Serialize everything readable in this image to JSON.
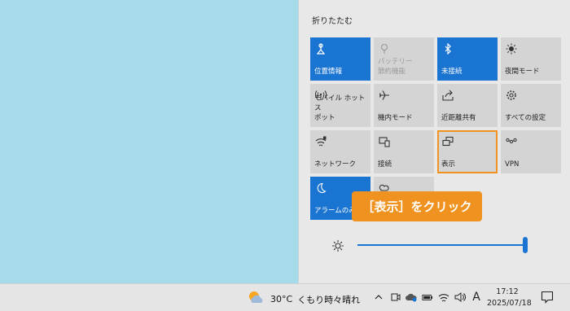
{
  "action_center": {
    "collapse_label": "折りたたむ",
    "tiles": [
      {
        "label": "位置情報",
        "icon": "location-icon",
        "state": "active"
      },
      {
        "label": "バッテリー\n節約機能",
        "icon": "battery-saver-icon",
        "state": "disabled"
      },
      {
        "label": "未接続",
        "icon": "bluetooth-icon",
        "state": "active"
      },
      {
        "label": "夜間モード",
        "icon": "brightness-icon",
        "state": "normal"
      },
      {
        "label": "モバイル ホットス\nポット",
        "icon": "mobile-hotspot-icon",
        "state": "normal"
      },
      {
        "label": "機内モード",
        "icon": "airplane-icon",
        "state": "normal"
      },
      {
        "label": "近距離共有",
        "icon": "share-icon",
        "state": "normal"
      },
      {
        "label": "すべての設定",
        "icon": "gear-icon",
        "state": "normal"
      },
      {
        "label": "ネットワーク",
        "icon": "network-icon",
        "state": "normal"
      },
      {
        "label": "接続",
        "icon": "connect-icon",
        "state": "normal"
      },
      {
        "label": "表示",
        "icon": "project-icon",
        "state": "highlight"
      },
      {
        "label": "VPN",
        "icon": "vpn-icon",
        "state": "normal"
      },
      {
        "label": "アラームのみ",
        "icon": "moon-icon",
        "state": "active"
      },
      {
        "label": "",
        "icon": "screen-snip-icon",
        "state": "normal"
      }
    ],
    "brightness": {
      "icon": "sun-icon",
      "level_percent": 100
    }
  },
  "callout": {
    "text": "［表示］をクリック"
  },
  "taskbar": {
    "weather": {
      "temp": "30°C",
      "condition": "くもり時々晴れ"
    },
    "time": "17:12",
    "date": "2025/07/18",
    "ime": "A"
  },
  "colors": {
    "accent": "#1a74d2",
    "highlight": "#f0921f",
    "desktop": "#a6dcea"
  }
}
